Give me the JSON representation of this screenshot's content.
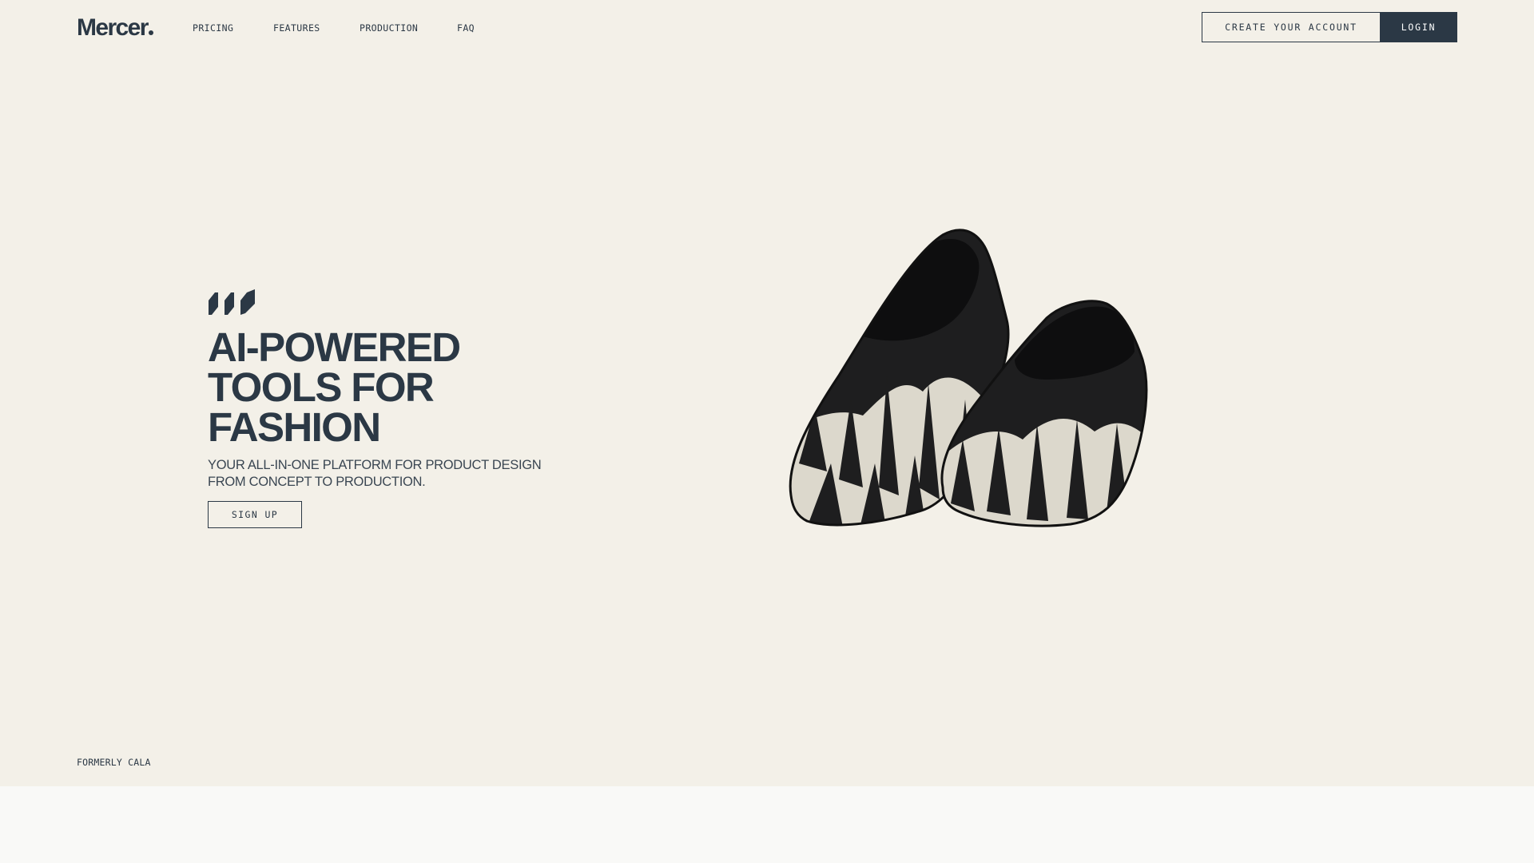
{
  "header": {
    "logo_text": "Mercer",
    "nav": [
      "PRICING",
      "FEATURES",
      "PRODUCTION",
      "FAQ"
    ],
    "create_account_label": "CREATE YOUR ACCOUNT",
    "login_label": "LOGIN"
  },
  "hero": {
    "mark_icon": "stripes-logo-icon",
    "headline": [
      "AI-POWERED",
      "TOOLS FOR",
      "FASHION"
    ],
    "subhead": [
      "YOUR ALL-IN-ONE PLATFORM FOR PRODUCT DESIGN",
      "FROM CONCEPT TO PRODUCTION."
    ],
    "signup_label": "SIGN UP",
    "image": "black-and-white-loafers-image"
  },
  "footer_note": "FORMERLY CALA",
  "colors": {
    "hero_background": "#f3f0e8",
    "page_background": "#f9f9f7",
    "primary": "#2b3845",
    "login_text": "#ffffff"
  }
}
